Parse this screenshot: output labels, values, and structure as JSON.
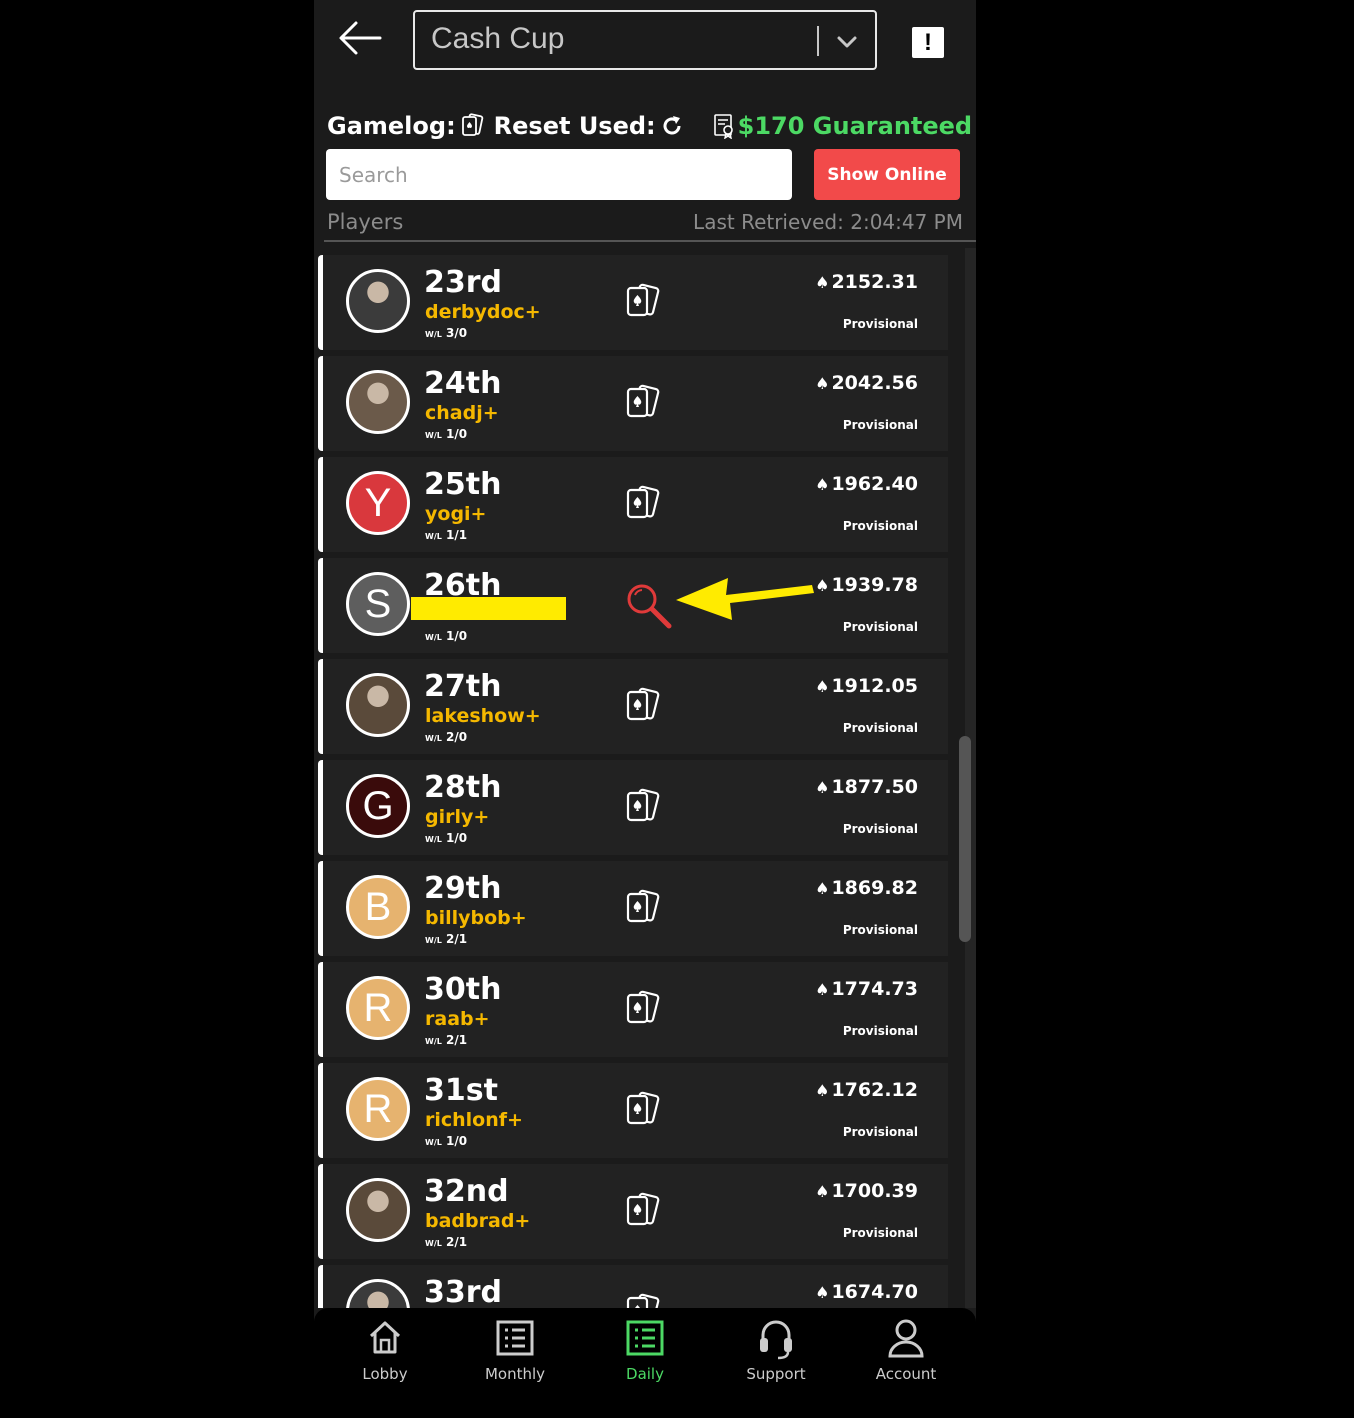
{
  "header": {
    "dropdown_value": "Cash Cup",
    "report_label": "!"
  },
  "infobar": {
    "gamelog_label": "Gamelog:",
    "reset_label": "Reset Used:",
    "guaranteed": "$170 Guaranteed",
    "guaranteed_color": "#4cd964"
  },
  "search": {
    "placeholder": "Search",
    "show_online_label": "Show Online"
  },
  "list_header": {
    "players_label": "Players",
    "last_retrieved": "Last Retrieved: 2:04:47 PM"
  },
  "rows": [
    {
      "rank": "23rd",
      "name": "derbydoc+",
      "wl_label": "W/L",
      "wl": "3/0",
      "score": "2152.31",
      "status": "Provisional",
      "avatar": "photo"
    },
    {
      "rank": "24th",
      "name": "chadj+",
      "wl_label": "W/L",
      "wl": "1/0",
      "score": "2042.56",
      "status": "Provisional",
      "avatar": "photo"
    },
    {
      "rank": "25th",
      "name": "yogi+",
      "wl_label": "W/L",
      "wl": "1/1",
      "score": "1962.40",
      "status": "Provisional",
      "avatar_letter": "Y",
      "avatar_color": "#d9383d"
    },
    {
      "rank": "26th",
      "name": "",
      "wl_label": "W/L",
      "wl": "1/0",
      "score": "1939.78",
      "status": "Provisional",
      "avatar_letter": "S",
      "avatar_color": "#5e5e5e",
      "redacted": true
    },
    {
      "rank": "27th",
      "name": "lakeshow+",
      "wl_label": "W/L",
      "wl": "2/0",
      "score": "1912.05",
      "status": "Provisional",
      "avatar": "photo"
    },
    {
      "rank": "28th",
      "name": "girly+",
      "wl_label": "W/L",
      "wl": "1/0",
      "score": "1877.50",
      "status": "Provisional",
      "avatar_letter": "G",
      "avatar_color": "#3a0b0b"
    },
    {
      "rank": "29th",
      "name": "billybob+",
      "wl_label": "W/L",
      "wl": "2/1",
      "score": "1869.82",
      "status": "Provisional",
      "avatar_letter": "B",
      "avatar_color": "#e6b36f"
    },
    {
      "rank": "30th",
      "name": "raab+",
      "wl_label": "W/L",
      "wl": "2/1",
      "score": "1774.73",
      "status": "Provisional",
      "avatar_letter": "R",
      "avatar_color": "#e6b36f"
    },
    {
      "rank": "31st",
      "name": "richlonf+",
      "wl_label": "W/L",
      "wl": "1/0",
      "score": "1762.12",
      "status": "Provisional",
      "avatar_letter": "R",
      "avatar_color": "#e6b36f"
    },
    {
      "rank": "32nd",
      "name": "badbrad+",
      "wl_label": "W/L",
      "wl": "2/1",
      "score": "1700.39",
      "status": "Provisional",
      "avatar": "photo"
    },
    {
      "rank": "33rd",
      "name": "",
      "wl_label": "W/L",
      "wl": "",
      "score": "1674.70",
      "status": "",
      "avatar": "photo"
    }
  ],
  "nav": [
    {
      "label": "Lobby",
      "icon": "home-icon"
    },
    {
      "label": "Monthly",
      "icon": "list-icon"
    },
    {
      "label": "Daily",
      "icon": "list-icon",
      "active": true
    },
    {
      "label": "Support",
      "icon": "headset-icon"
    },
    {
      "label": "Account",
      "icon": "user-icon"
    }
  ],
  "colors": {
    "accent_green": "#4cd964",
    "username_gold": "#f5b800",
    "show_online_red": "#f24a4a",
    "annotation_arrow": "#ffeb00",
    "magnifier_red": "#e03a3a"
  }
}
